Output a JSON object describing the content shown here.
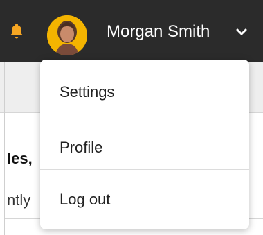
{
  "header": {
    "username": "Morgan Smith"
  },
  "icons": {
    "bell": "bell-icon",
    "avatar": "avatar",
    "chevron": "chevron-down-icon"
  },
  "background": {
    "heading_fragment": "les,",
    "subtext_fragment": "ntly"
  },
  "menu": {
    "items": [
      {
        "label": "Settings"
      },
      {
        "label": "Profile"
      },
      {
        "label": "Log out"
      }
    ]
  },
  "colors": {
    "topbar": "#2b2b2b",
    "bell": "#f6a623",
    "avatar_bg": "#f4b400"
  }
}
